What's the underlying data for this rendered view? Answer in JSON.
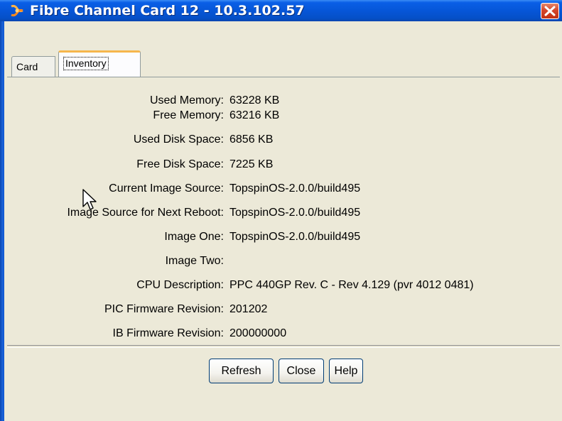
{
  "window": {
    "title": "Fibre Channel Card 12 - 10.3.102.57",
    "icon": "fibre-channel-app-icon",
    "close_icon": "close-icon"
  },
  "tabs": [
    {
      "label": "Card",
      "selected": false
    },
    {
      "label": "Inventory",
      "selected": true
    }
  ],
  "inventory": [
    {
      "label": "Used Memory:",
      "value": "63228 KB"
    },
    {
      "label": "Free Memory:",
      "value": "63216 KB"
    },
    {
      "label": "Used Disk Space:",
      "value": "6856 KB"
    },
    {
      "label": "Free Disk Space:",
      "value": "7225 KB"
    },
    {
      "label": "Current Image Source:",
      "value": "TopspinOS-2.0.0/build495"
    },
    {
      "label": "Image Source for Next Reboot:",
      "value": "TopspinOS-2.0.0/build495"
    },
    {
      "label": "Image One:",
      "value": "TopspinOS-2.0.0/build495"
    },
    {
      "label": "Image Two:",
      "value": ""
    },
    {
      "label": "CPU Description:",
      "value": "PPC 440GP Rev. C - Rev 4.129 (pvr 4012 0481)"
    },
    {
      "label": "PIC Firmware Revision:",
      "value": "201202"
    },
    {
      "label": "IB Firmware Revision:",
      "value": "200000000"
    }
  ],
  "buttons": {
    "refresh": "Refresh",
    "close": "Close",
    "help": "Help"
  },
  "colors": {
    "titlebar": "#0656d8",
    "close_button": "#d5452a",
    "selected_tab_accent": "#f6b64c",
    "dialog_background": "#ece9d8"
  }
}
